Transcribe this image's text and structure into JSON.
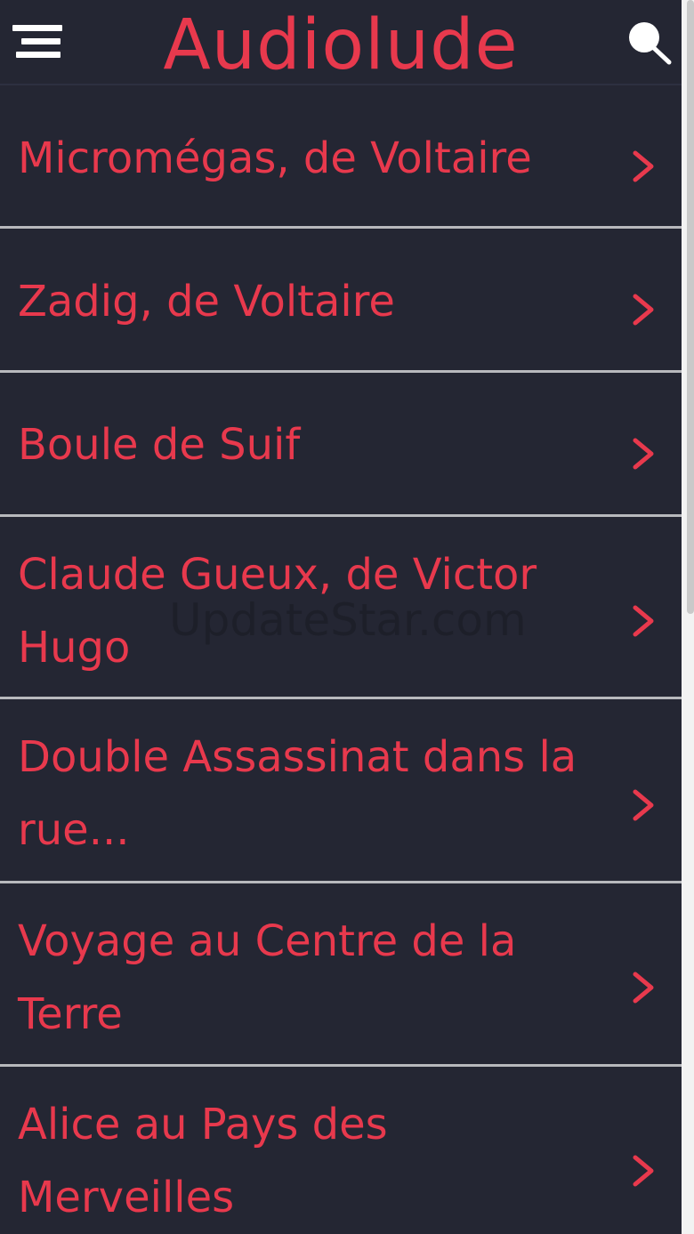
{
  "app": {
    "title": "Audiolude",
    "accent_color": "#e8394d",
    "background_color": "#242633",
    "divider_color": "#b8b9bd"
  },
  "header": {
    "menu_icon": "hamburger-menu-icon",
    "search_icon": "search-icon"
  },
  "list": {
    "items": [
      {
        "label": "Micromégas, de Voltaire",
        "icon": "chevron-right-icon"
      },
      {
        "label": "Zadig, de Voltaire",
        "icon": "chevron-right-icon"
      },
      {
        "label": "Boule de Suif",
        "icon": "chevron-right-icon"
      },
      {
        "label": "Claude Gueux, de Victor Hugo",
        "icon": "chevron-right-icon"
      },
      {
        "label": "Double Assassinat dans la rue...",
        "icon": "chevron-right-icon"
      },
      {
        "label": "Voyage au Centre de la Terre",
        "icon": "chevron-right-icon"
      },
      {
        "label": "Alice au Pays des Merveilles",
        "icon": "chevron-right-icon"
      }
    ]
  },
  "watermark": "UpdateStar.com"
}
